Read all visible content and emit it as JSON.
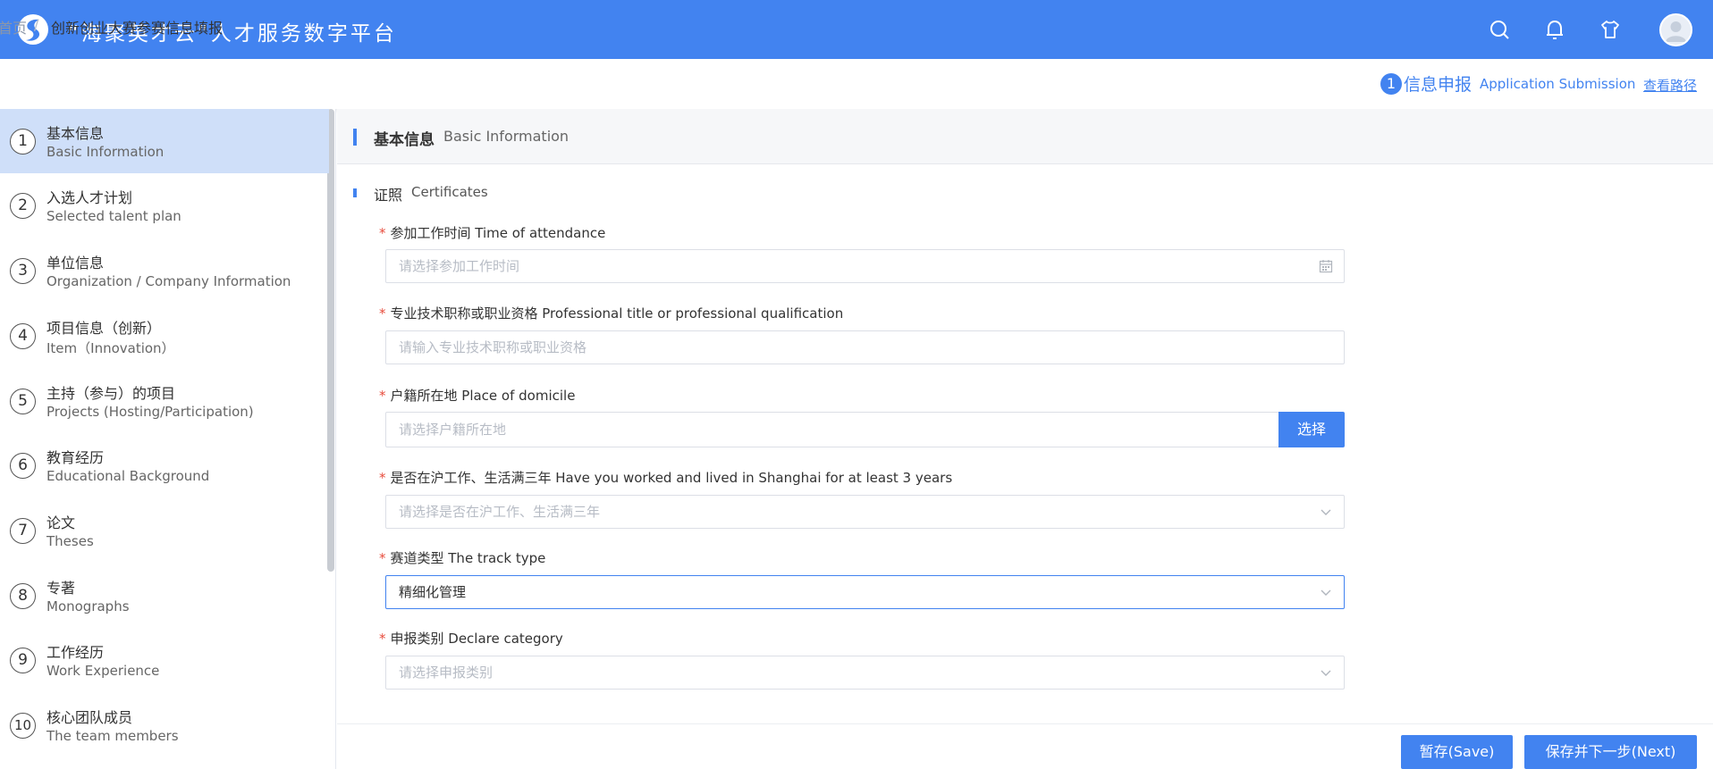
{
  "header": {
    "app_title": "“海聚英才云”人才服务数字平台",
    "icons": [
      "search-icon",
      "bell-icon",
      "shirt-icon"
    ]
  },
  "breadcrumb": {
    "home": "首页",
    "separator": "/",
    "current": "创新创业大赛参赛信息填报"
  },
  "progress": {
    "step_number": "1",
    "step_cn": "信息申报",
    "step_en": "Application Submission",
    "view_path": "查看路径"
  },
  "sidebar": {
    "items": [
      {
        "num": "1",
        "cn": "基本信息",
        "en": "Basic Information",
        "active": true
      },
      {
        "num": "2",
        "cn": "入选人才计划",
        "en": "Selected talent plan"
      },
      {
        "num": "3",
        "cn": "单位信息",
        "en": "Organization / Company Information"
      },
      {
        "num": "4",
        "cn": "项目信息（创新）",
        "en": "Item（Innovation）"
      },
      {
        "num": "5",
        "cn": "主持（参与）的项目",
        "en": "Projects (Hosting/Participation)"
      },
      {
        "num": "6",
        "cn": "教育经历",
        "en": "Educational Background"
      },
      {
        "num": "7",
        "cn": "论文",
        "en": "Theses"
      },
      {
        "num": "8",
        "cn": "专著",
        "en": "Monographs"
      },
      {
        "num": "9",
        "cn": "工作经历",
        "en": "Work Experience"
      },
      {
        "num": "10",
        "cn": "核心团队成员",
        "en": "The team members"
      }
    ]
  },
  "section": {
    "title_cn": "基本信息",
    "title_en": "Basic Information",
    "sub_cn": "证照",
    "sub_en": "Certificates"
  },
  "form": {
    "work_time": {
      "label": "参加工作时间 Time of attendance",
      "placeholder": "请选择参加工作时间"
    },
    "title_qual": {
      "label": "专业技术职称或职业资格 Professional title or professional qualification",
      "placeholder": "请输入专业技术职称或职业资格"
    },
    "domicile": {
      "label": "户籍所在地 Place of domicile",
      "placeholder": "请选择户籍所在地",
      "button": "选择"
    },
    "shanghai": {
      "label": "是否在沪工作、生活满三年 Have you worked and lived in Shanghai for at least 3 years",
      "placeholder": "请选择是否在沪工作、生活满三年"
    },
    "track": {
      "label": "赛道类型 The track type",
      "value": "精细化管理"
    },
    "category": {
      "label": "申报类别 Declare category",
      "placeholder": "请选择申报类别"
    },
    "required_mark": "*"
  },
  "footer": {
    "save": "暂存(Save)",
    "next": "保存并下一步(Next)"
  },
  "colors": {
    "accent": "#4283f0",
    "active_bg": "#cfdff9",
    "required": "#e74c3c"
  }
}
